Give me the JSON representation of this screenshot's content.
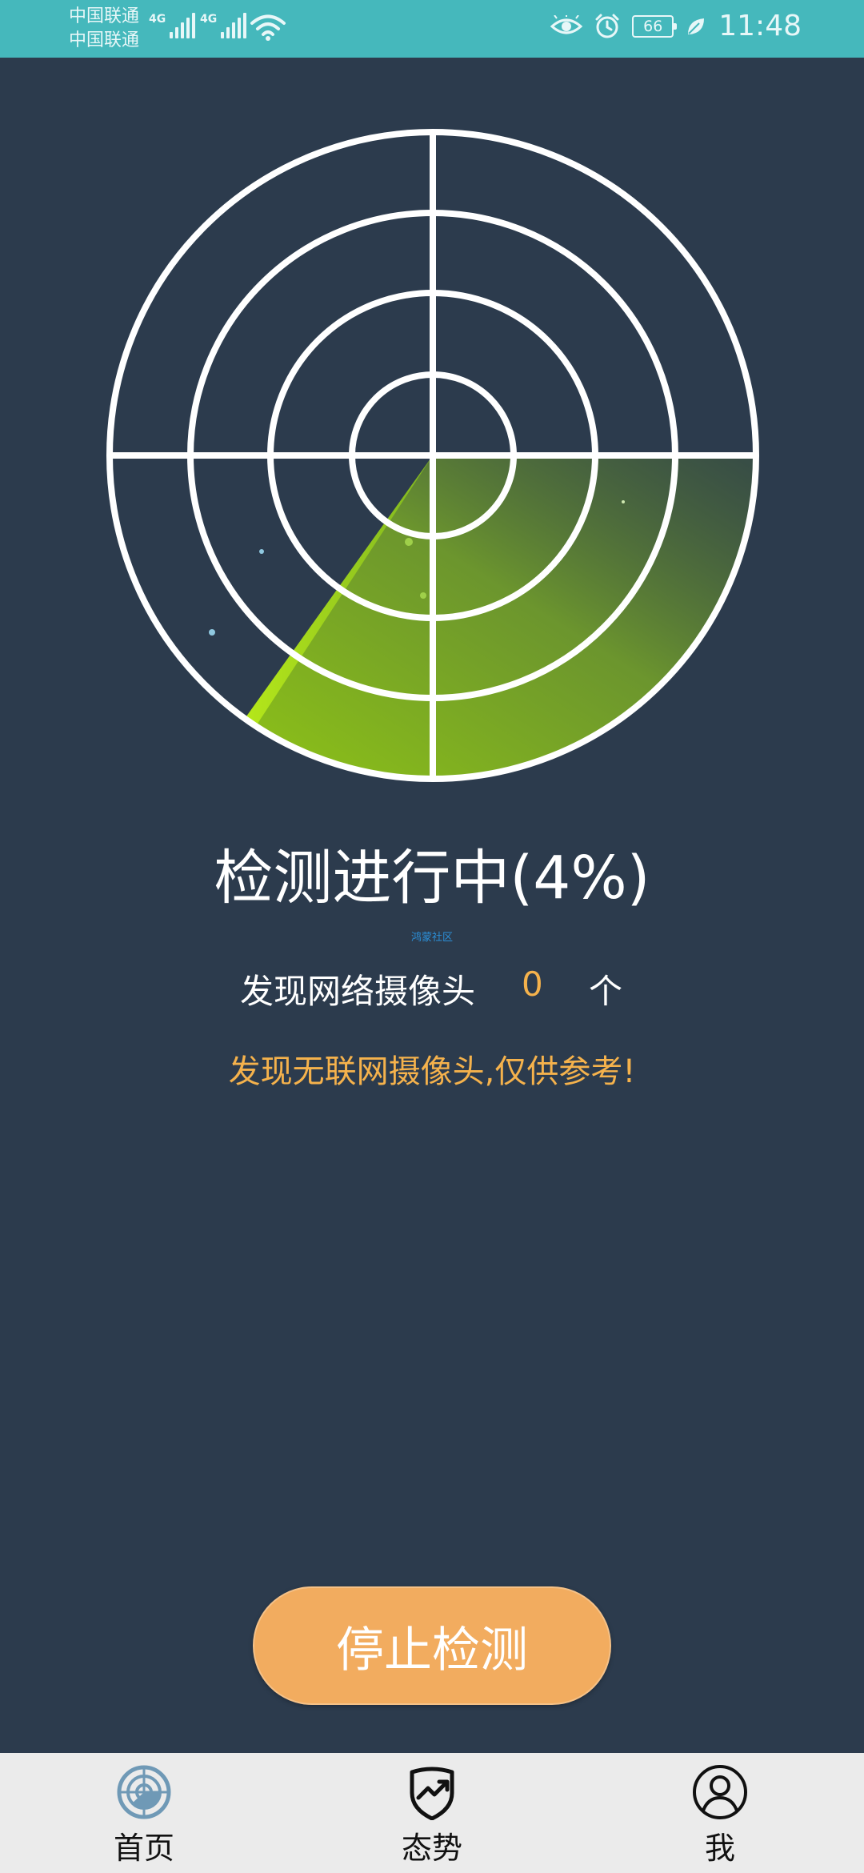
{
  "status_bar": {
    "carrier1": "中国联通",
    "carrier2": "中国联通",
    "network1": "4G",
    "network2": "4G",
    "battery": "66",
    "time": "11:48"
  },
  "scan": {
    "status": "检测进行中(4%)",
    "progress_percent": 4,
    "watermark": "鸿蒙社区",
    "found_label": "发现网络摄像头",
    "found_count": "0",
    "found_unit": "个",
    "notice": "发现无联网摄像头,仅供参考!"
  },
  "actions": {
    "stop_label": "停止检测"
  },
  "bottom_nav": {
    "items": [
      {
        "label": "首页",
        "icon": "radar-icon",
        "active": true
      },
      {
        "label": "态势",
        "icon": "trend-shield-icon"
      },
      {
        "label": "我",
        "icon": "person-icon"
      }
    ]
  },
  "colors": {
    "status_bar": "#45b8bc",
    "background": "#2c3b4d",
    "accent": "#f5b24c",
    "button": "#f2ac5f",
    "sweep": "#7fb520"
  }
}
